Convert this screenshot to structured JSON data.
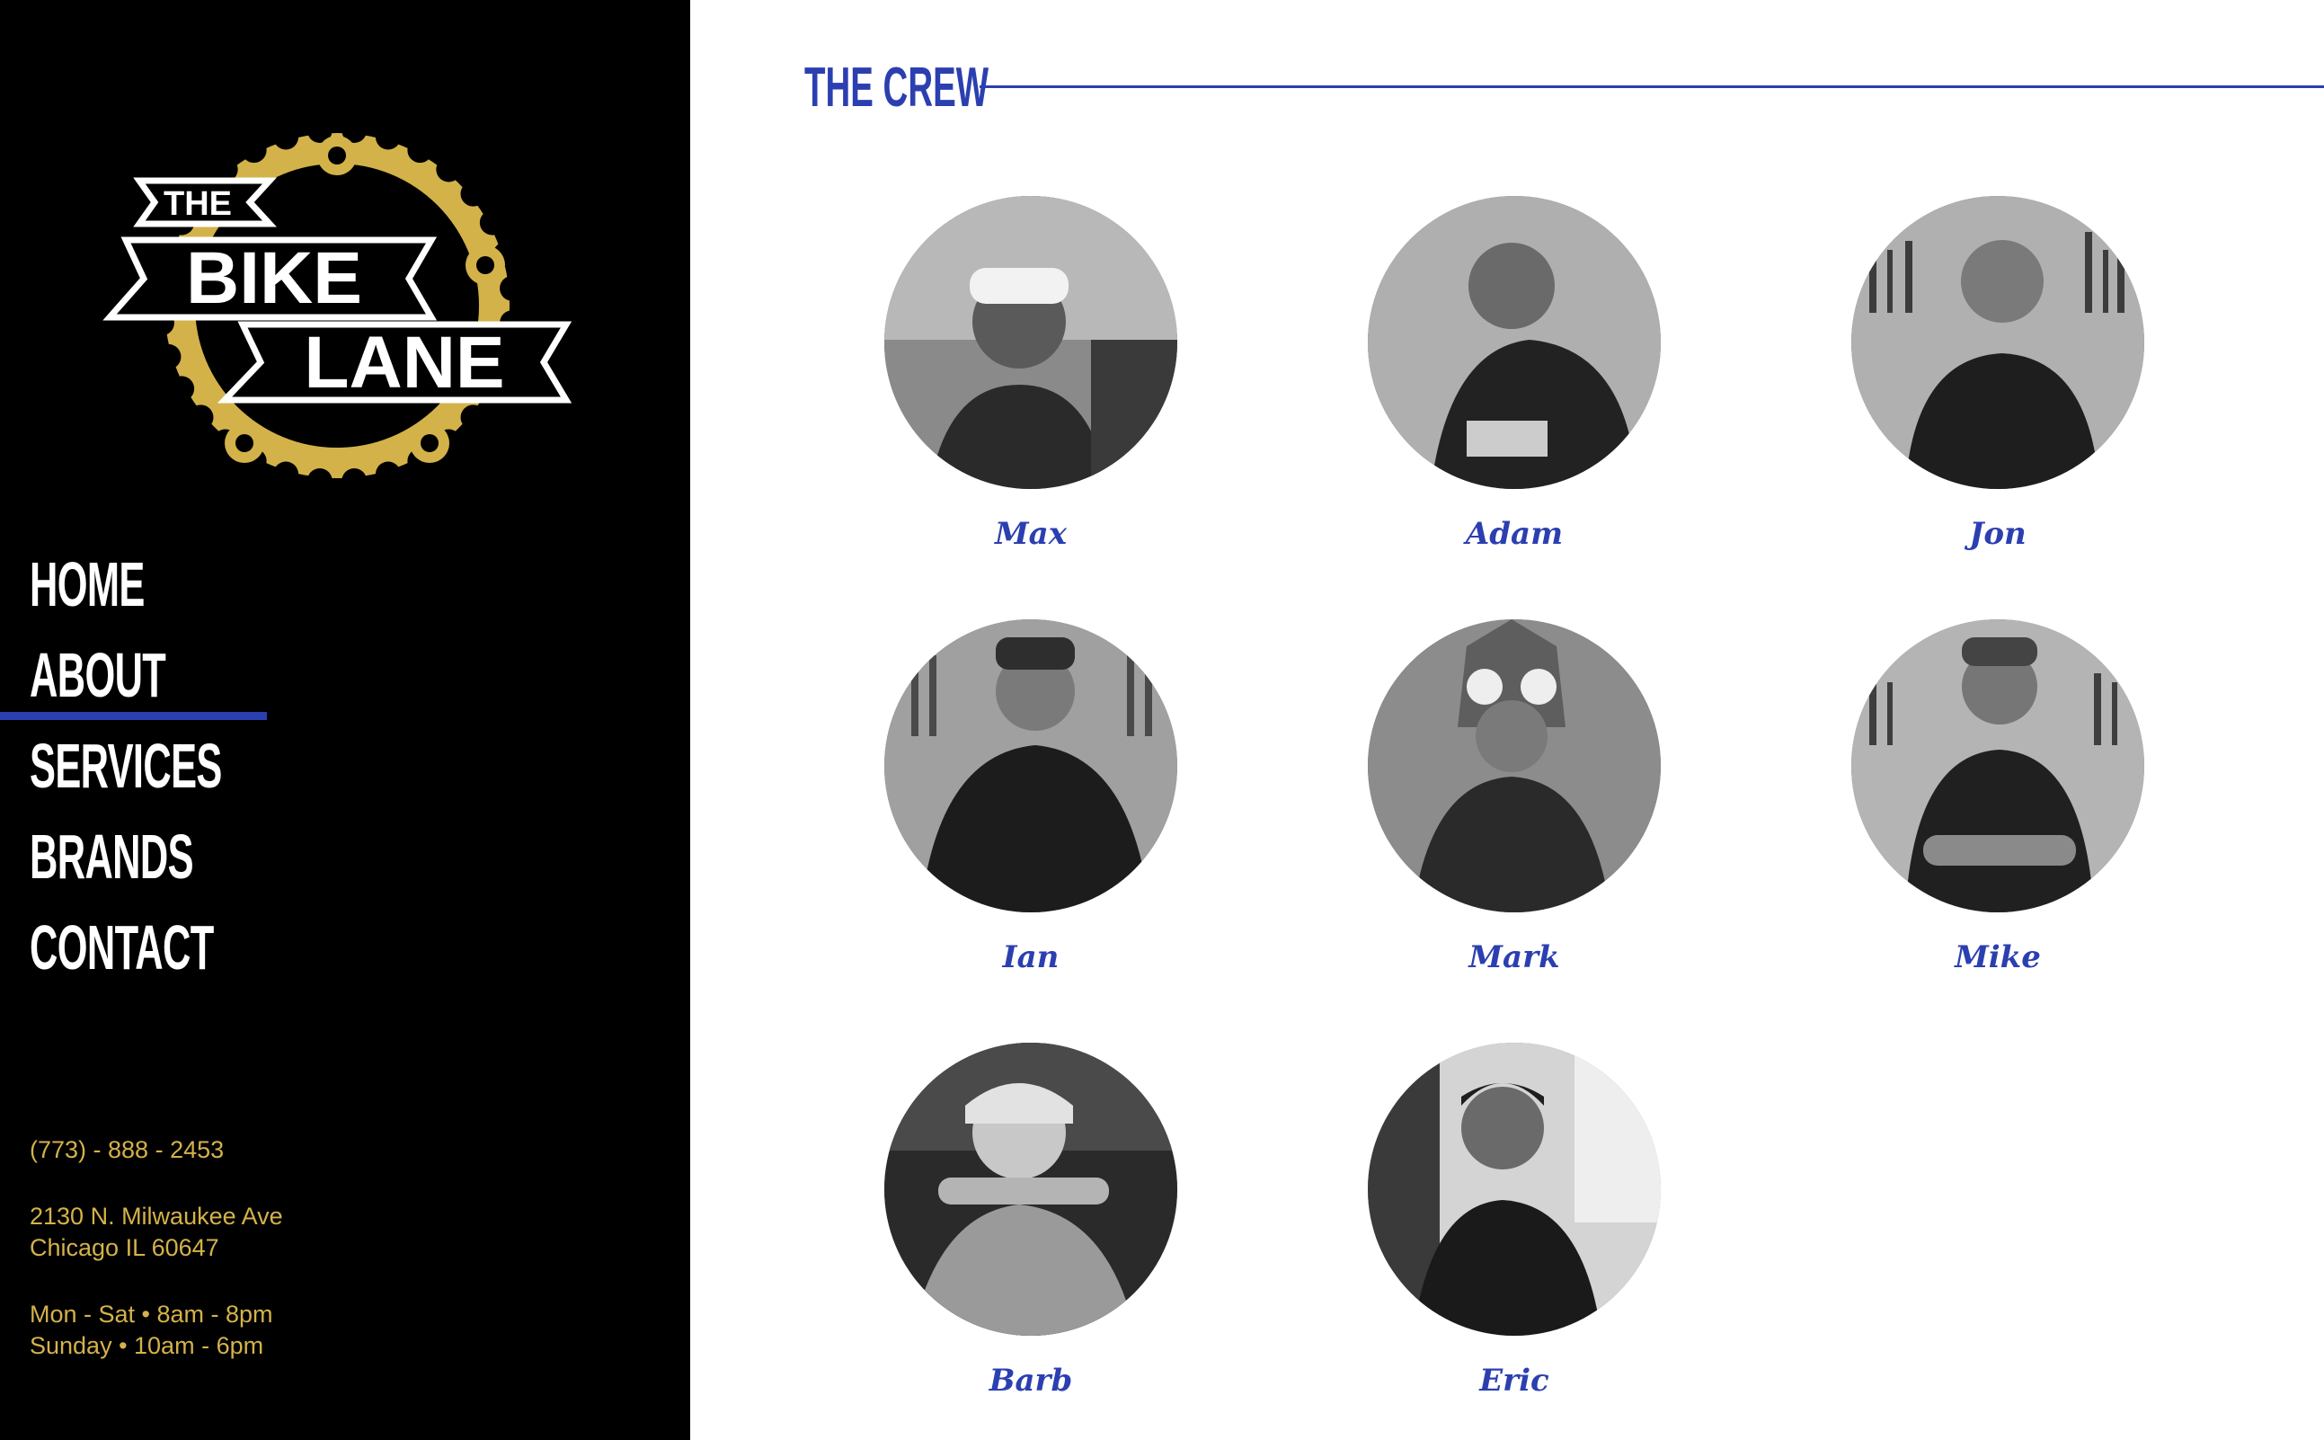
{
  "brand": {
    "logo_line1": "THE",
    "logo_line2": "BIKE",
    "logo_line3": "LANE",
    "logo_gold": "#d4b24a"
  },
  "nav": {
    "items": [
      {
        "label": "HOME",
        "active": false
      },
      {
        "label": "ABOUT",
        "active": true
      },
      {
        "label": "SERVICES",
        "active": false
      },
      {
        "label": "BRANDS",
        "active": false
      },
      {
        "label": "CONTACT",
        "active": false
      }
    ]
  },
  "contact": {
    "phone": "(773) - 888 - 2453",
    "address_line1": "2130 N. Milwaukee Ave",
    "address_line2": "Chicago IL 60647",
    "hours_line1": "Mon - Sat • 8am - 8pm",
    "hours_line2": "Sunday • 10am - 6pm"
  },
  "section": {
    "title": "THE CREW"
  },
  "crew": [
    {
      "name": "Max"
    },
    {
      "name": "Adam"
    },
    {
      "name": "Jon"
    },
    {
      "name": "Ian"
    },
    {
      "name": "Mark"
    },
    {
      "name": "Mike"
    },
    {
      "name": "Barb"
    },
    {
      "name": "Eric"
    }
  ],
  "colors": {
    "sidebar_bg": "#000000",
    "accent_blue": "#2c3fb0",
    "gold": "#d4b24a"
  }
}
